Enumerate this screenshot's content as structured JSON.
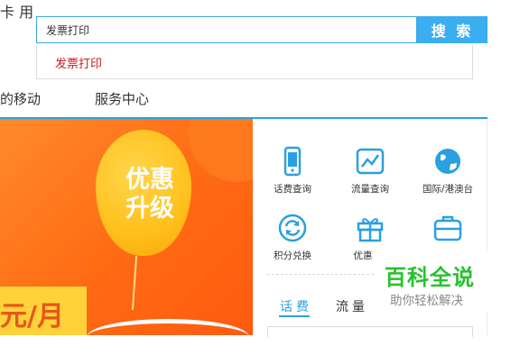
{
  "search": {
    "value": "发票打印",
    "button_label": "搜 索",
    "suggestions": [
      "发票打印"
    ]
  },
  "nav": {
    "items": [
      "的移动",
      "服务中心"
    ]
  },
  "banner": {
    "big_text_1": "卡",
    "big_text_2": "用",
    "balloon_line1": "优惠",
    "balloon_line2": "升级",
    "price": "元/月"
  },
  "quick_services": [
    {
      "label": "话费查询",
      "icon": "phone-icon"
    },
    {
      "label": "流量查询",
      "icon": "chart-icon"
    },
    {
      "label": "国际/港澳台",
      "icon": "globe-icon"
    },
    {
      "label": "积分兑换",
      "icon": "refresh-icon"
    },
    {
      "label": "优惠",
      "icon": "gift-icon"
    },
    {
      "label": "",
      "icon": "briefcase-icon"
    }
  ],
  "tabs": [
    "话费",
    "流量"
  ],
  "watermark": {
    "title": "百科全说",
    "subtitle": "助你轻松解决"
  },
  "colors": {
    "accent": "#29a1e2",
    "banner_orange": "#ff6a12",
    "balloon_yellow": "#ffbf1c",
    "suggest_red": "#c81e1e",
    "watermark_green": "#27c12e"
  }
}
